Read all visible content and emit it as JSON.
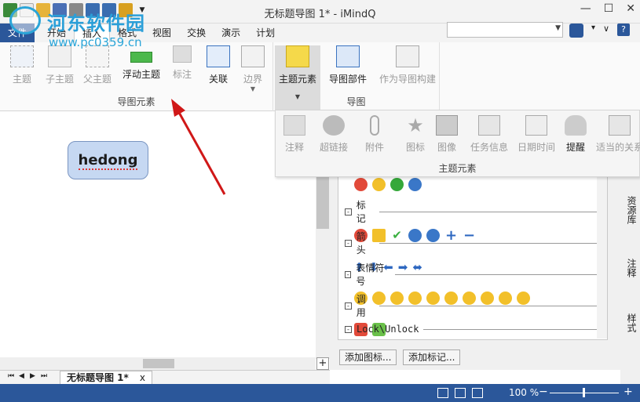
{
  "window": {
    "title": "无标题导图 1* - iMindQ"
  },
  "tabs": {
    "file": "文件",
    "items": [
      "开始",
      "插入",
      "格式",
      "视图",
      "交换",
      "演示",
      "计划"
    ]
  },
  "ribbon": {
    "group1": {
      "label": "导图元素",
      "buttons": [
        "主题",
        "子主题",
        "父主题",
        "浮动主题",
        "标注",
        "关联",
        "边界"
      ]
    },
    "group2": {
      "label": "导图",
      "buttons": [
        "主题元素",
        "导图部件",
        "作为导图构建"
      ]
    }
  },
  "popup": {
    "label": "主题元素",
    "buttons": [
      "注释",
      "超链接",
      "附件",
      "图标",
      "图像",
      "任务信息",
      "日期时间",
      "提醒",
      "适当的关系"
    ]
  },
  "canvas": {
    "node_text": "hedong"
  },
  "sheet": {
    "tab": "无标题导图 1*",
    "close": "x"
  },
  "panel": {
    "categories": [
      "标记",
      "箭头",
      "表情符号",
      "调用",
      "Lock\\Unlock"
    ],
    "add_icon_button": "添加图标...",
    "add_mark_button": "添加标记..."
  },
  "side_tabs": [
    "资源库",
    "注释",
    "样式"
  ],
  "status": {
    "zoom_percent": "100",
    "zoom_unit": "%"
  },
  "watermark": {
    "title": "河东软件园",
    "url": "www.pc0359.cn"
  },
  "colors": {
    "accent": "#2b579a",
    "node_fill": "#c6d8f2",
    "arrow": "#d01818"
  }
}
